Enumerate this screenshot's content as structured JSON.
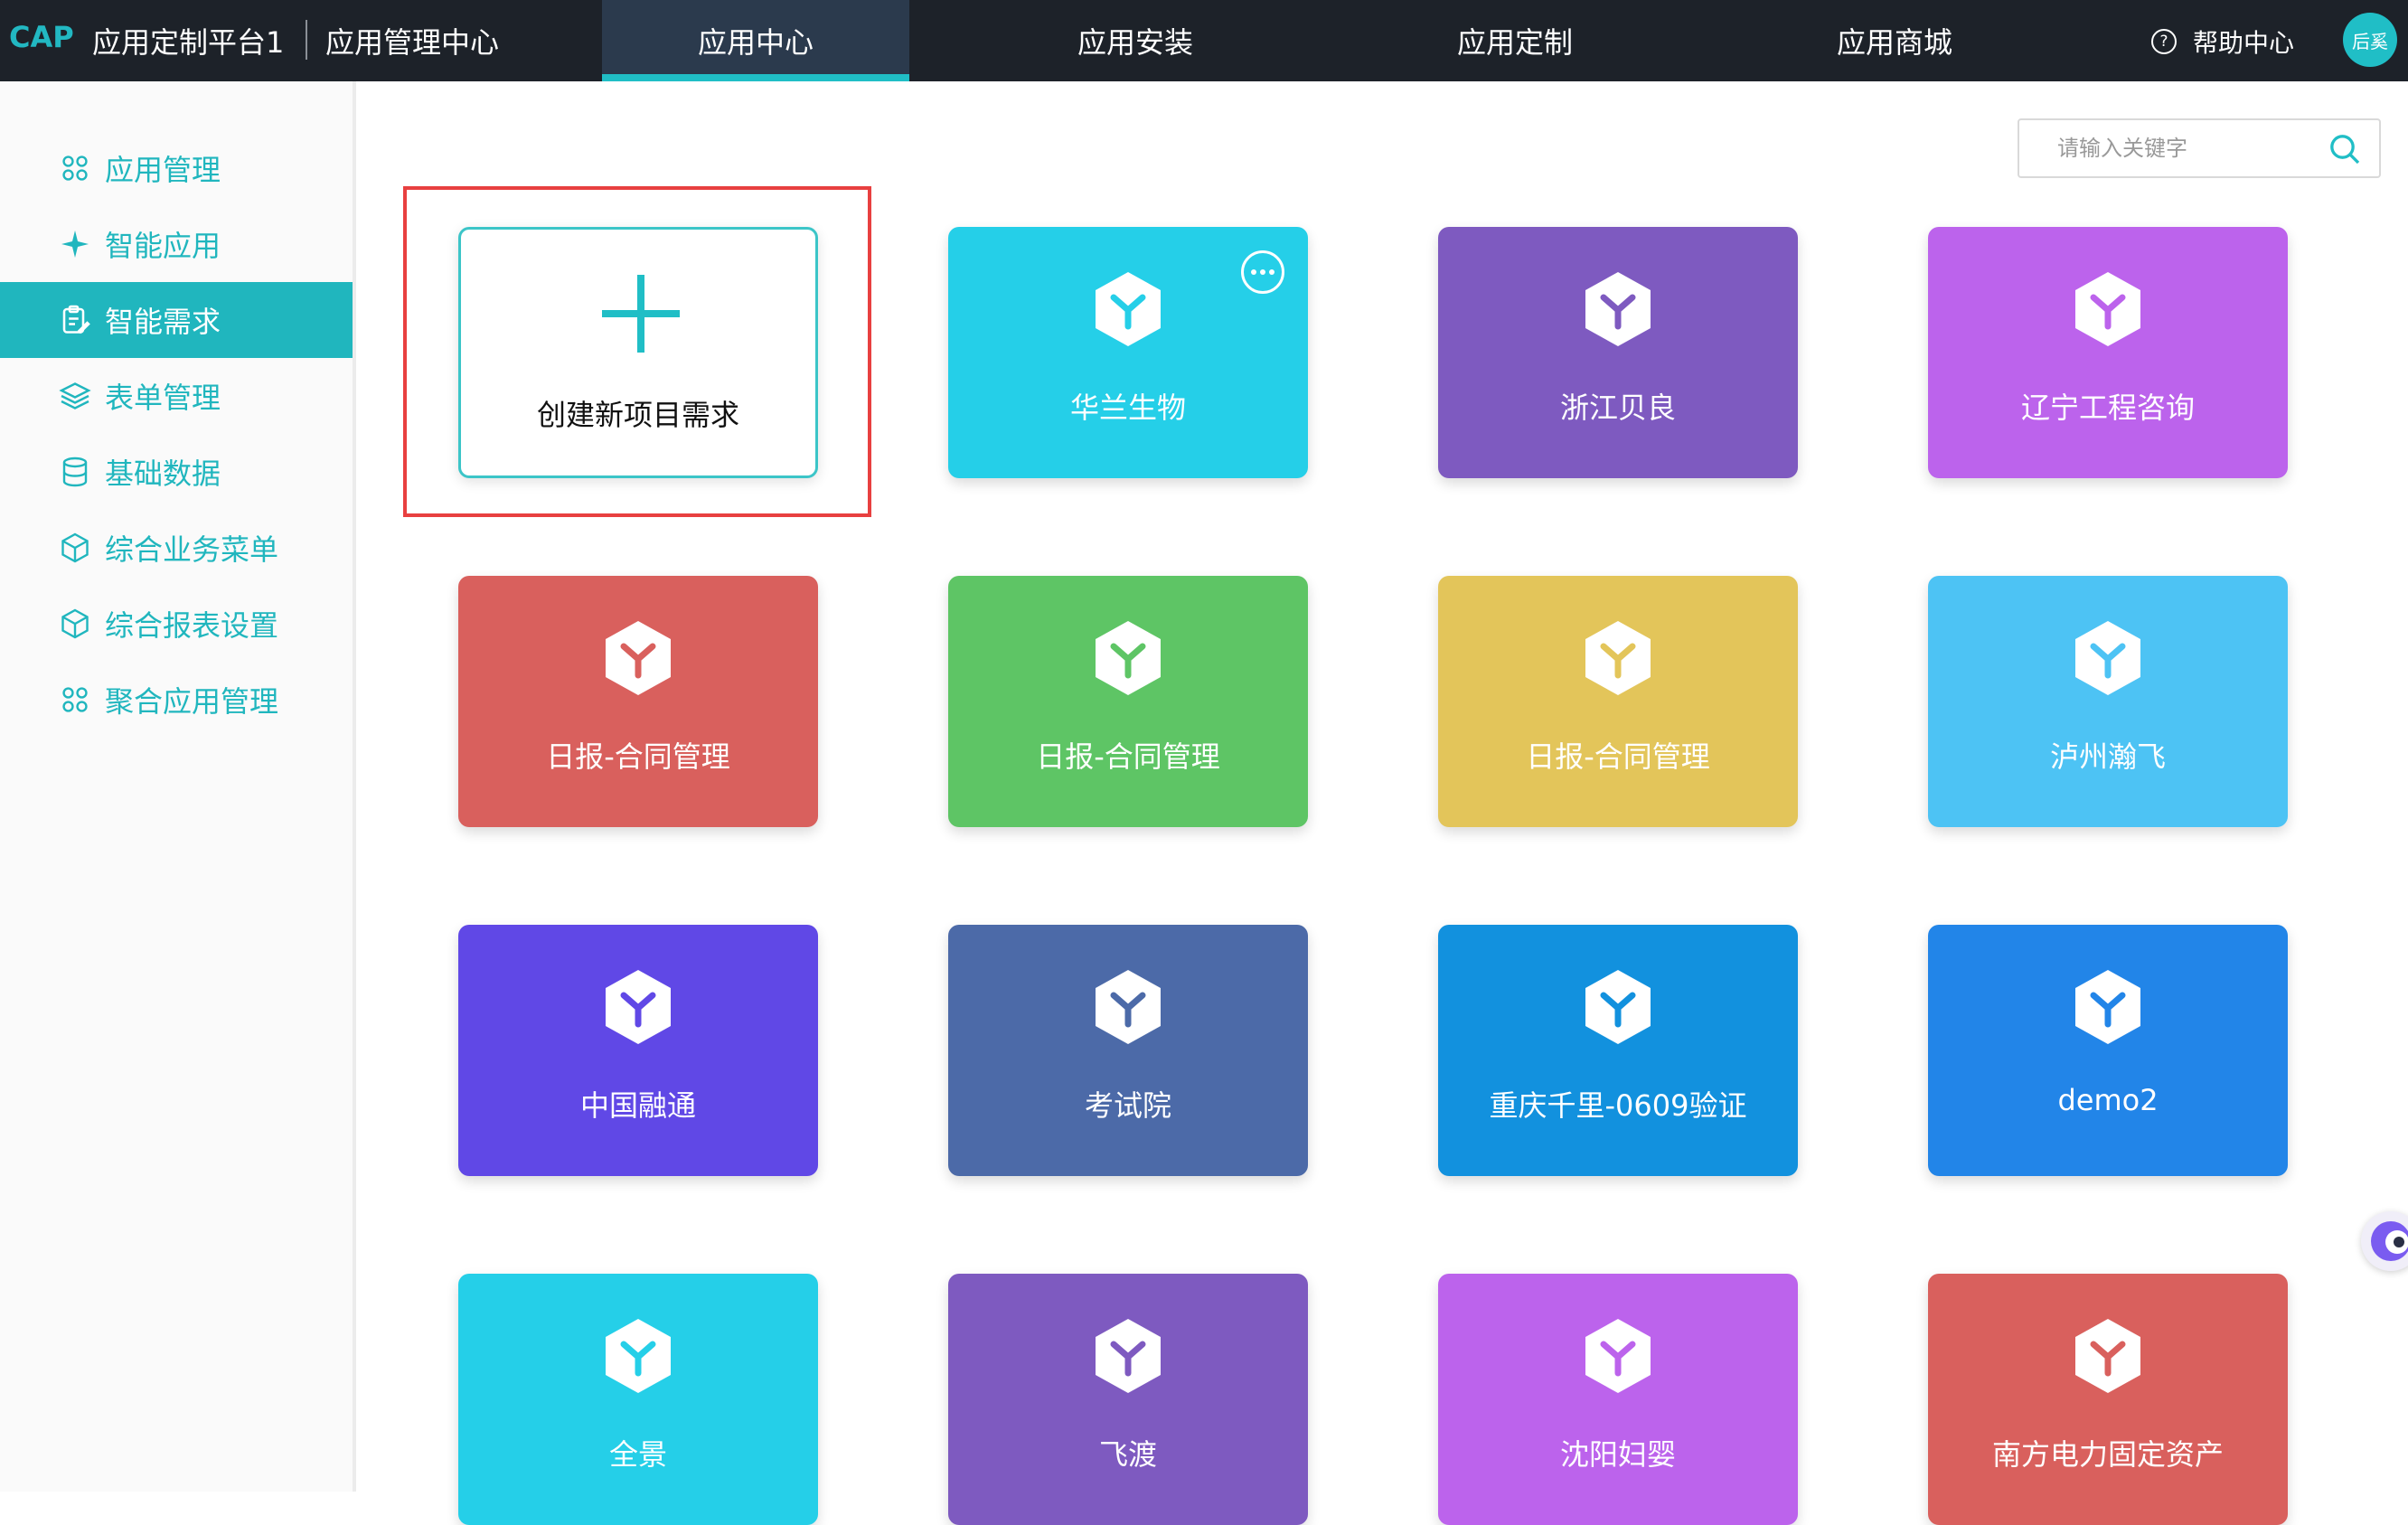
{
  "header": {
    "brand": "CAP",
    "platform": "应用定制平台1",
    "center_name": "应用管理中心",
    "tabs": [
      {
        "label": "应用中心"
      },
      {
        "label": "应用安装"
      },
      {
        "label": "应用定制"
      },
      {
        "label": "应用商城"
      }
    ],
    "active_tab": "应用中心",
    "help_label": "帮助中心",
    "help_icon": "?",
    "avatar_text": "后奚"
  },
  "sidebar": {
    "items": [
      {
        "label": "应用管理",
        "icon": "grid-icon"
      },
      {
        "label": "智能应用",
        "icon": "sparkle-icon"
      },
      {
        "label": "智能需求",
        "icon": "clipboard-icon"
      },
      {
        "label": "表单管理",
        "icon": "layers-icon"
      },
      {
        "label": "基础数据",
        "icon": "database-icon"
      },
      {
        "label": "综合业务菜单",
        "icon": "cube-icon"
      },
      {
        "label": "综合报表设置",
        "icon": "cube-icon"
      },
      {
        "label": "聚合应用管理",
        "icon": "grid-icon"
      }
    ],
    "active_item": "智能需求",
    "accent_color": "#20b6be"
  },
  "search": {
    "placeholder": "请输入关键字",
    "value": ""
  },
  "create_card": {
    "label": "创建新项目需求"
  },
  "apps": [
    {
      "name": "华兰生物",
      "color": "#25cfe8",
      "cube_color": "#25cfe8"
    },
    {
      "name": "浙江贝良",
      "color": "#7e5ac0",
      "cube_color": "#7e5ac0"
    },
    {
      "name": "辽宁工程咨询",
      "color": "#bc63ec",
      "cube_color": "#bc63ec"
    },
    {
      "name": "日报-合同管理",
      "color": "#d9605d",
      "cube_color": "#d9605d"
    },
    {
      "name": "日报-合同管理",
      "color": "#5ec565",
      "cube_color": "#5ec565"
    },
    {
      "name": "日报-合同管理",
      "color": "#e3c55a",
      "cube_color": "#e3c55a"
    },
    {
      "name": "泸州瀚飞",
      "color": "#4dc3f4",
      "cube_color": "#4dc3f4"
    },
    {
      "name": "中国融通",
      "color": "#6048e6",
      "cube_color": "#6048e6"
    },
    {
      "name": "考试院",
      "color": "#4c6aa8",
      "cube_color": "#4c6aa8"
    },
    {
      "name": "重庆千里-0609验证",
      "color": "#1291de",
      "cube_color": "#1291de"
    },
    {
      "name": "demo2",
      "color": "#2285e8",
      "cube_color": "#2285e8"
    },
    {
      "name": "全景",
      "color": "#25cfe8",
      "cube_color": "#25cfe8"
    },
    {
      "name": "飞渡",
      "color": "#7e5ac0",
      "cube_color": "#7e5ac0"
    },
    {
      "name": "沈阳妇婴",
      "color": "#bc63ec",
      "cube_color": "#bc63ec"
    },
    {
      "name": "南方电力固定资产",
      "color": "#d9605d",
      "cube_color": "#d9605d"
    }
  ]
}
